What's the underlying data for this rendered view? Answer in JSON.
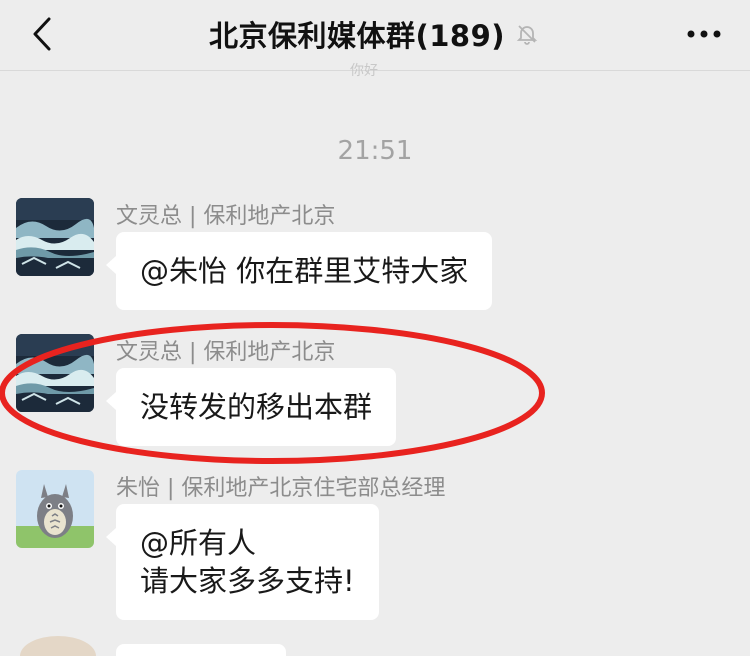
{
  "header": {
    "title": "北京保利媒体群(189)",
    "icons": [
      "back-chevron-icon",
      "mute-bell-icon",
      "more-dots-icon"
    ]
  },
  "chat": {
    "ghost_text": "你好",
    "time_divider": "21:51",
    "messages": [
      {
        "sender": "文灵总 | 保利地产北京",
        "lines": [
          "@朱怡 你在群里艾特大家"
        ],
        "avatar": "wave-painting-avatar"
      },
      {
        "sender": "文灵总 | 保利地产北京",
        "lines": [
          "没转发的移出本群"
        ],
        "avatar": "wave-painting-avatar",
        "highlight": true
      },
      {
        "sender": "朱怡 | 保利地产北京住宅部总经理",
        "lines": [
          "@所有人",
          "请大家多多支持!"
        ],
        "avatar": "totoro-avatar"
      }
    ]
  },
  "colors": {
    "background": "#ededed",
    "bubble": "#ffffff",
    "highlight_ring": "#e8231f",
    "sender_text": "#8c8c8c",
    "time_text": "#a3a3a3"
  }
}
